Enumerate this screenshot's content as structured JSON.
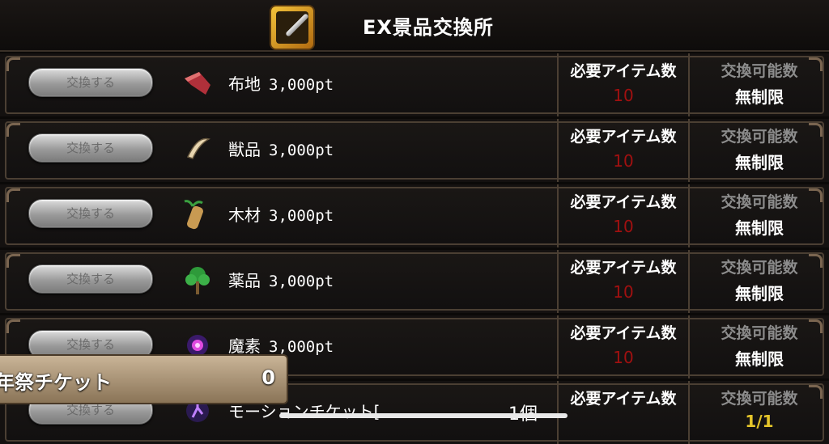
{
  "header": {
    "title": "EX景品交換所",
    "icon": "exchange-shop-icon"
  },
  "columns": {
    "required_label": "必要アイテム数",
    "exchangeable_label": "交換可能数"
  },
  "rows": [
    {
      "button": "交換する",
      "icon": "cloth-icon",
      "name": "布地",
      "points": "3,000pt",
      "required": "10",
      "exchangeable": "無制限"
    },
    {
      "button": "交換する",
      "icon": "fang-icon",
      "name": "獣品",
      "points": "3,000pt",
      "required": "10",
      "exchangeable": "無制限"
    },
    {
      "button": "交換する",
      "icon": "wood-icon",
      "name": "木材",
      "points": "3,000pt",
      "required": "10",
      "exchangeable": "無制限"
    },
    {
      "button": "交換する",
      "icon": "herb-icon",
      "name": "薬品",
      "points": "3,000pt",
      "required": "10",
      "exchangeable": "無制限"
    },
    {
      "button": "交換する",
      "icon": "magic-orb-icon",
      "name": "魔素",
      "points": "3,000pt",
      "required": "10",
      "exchangeable": "無制限"
    },
    {
      "button": "交換する",
      "icon": "motion-icon",
      "name": "モーションチケット[",
      "points": "",
      "required": "",
      "exchangeable": "1/1"
    }
  ],
  "popup": {
    "label": "年祭チケット",
    "count": "0"
  },
  "overlay": {
    "count": "1個"
  },
  "colors": {
    "required_value": "#a01010",
    "exchangeable_label": "#8c8c8c",
    "partial_value": "#e5c52a"
  }
}
